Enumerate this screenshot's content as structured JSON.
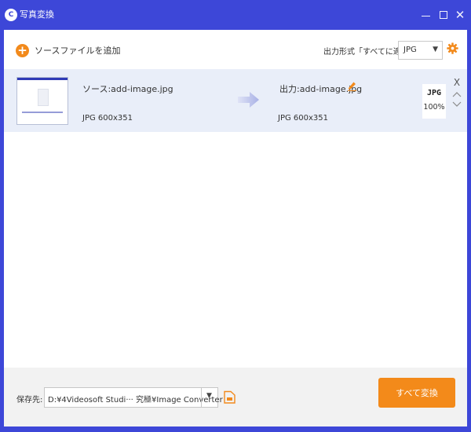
{
  "app": {
    "logo_text": "C",
    "title": "写真変換"
  },
  "window_controls": {
    "close_glyph": "✕"
  },
  "toolbar": {
    "add_label": "ソースファイルを追加",
    "format_label": "出力形式「すべてに適用」:",
    "format_value": "JPG",
    "dropdown_glyph": "▼"
  },
  "files": [
    {
      "source_name": "ソース:add-image.jpg",
      "source_info": "JPG  600x351",
      "output_name": "出力:add-image.jpg",
      "output_info": "JPG  600x351",
      "format_badge": "JPG",
      "quality": "100%",
      "remove_glyph": "X"
    }
  ],
  "bottom": {
    "save_label": "保存先:",
    "save_path": "D:¥4Videosoft Studi··· 究極¥Image Converter",
    "convert_label": "すべて変換"
  },
  "colors": {
    "brand_blue": "#3d47d8",
    "accent_orange": "#f38a1a",
    "row_bg": "#e9eef9"
  }
}
